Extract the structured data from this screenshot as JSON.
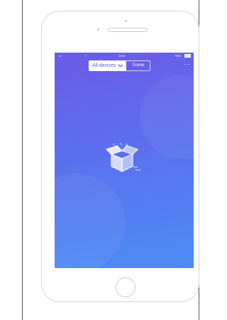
{
  "status_bar": {
    "signal": "•ıl",
    "wifi": "⌔",
    "time": "15:57",
    "battery_text": "99%"
  },
  "tabs": [
    {
      "label": "All devices",
      "active": true
    },
    {
      "label": "Scene",
      "active": false
    }
  ],
  "more_label": "···",
  "icons": {
    "dropdown": "chevron-down-icon",
    "empty": "empty-box-icon",
    "devices": "devices-grid-icon",
    "add": "add-icon",
    "profile": "profile-icon"
  },
  "colors": {
    "gradient_top": "#6a5be6",
    "gradient_bottom": "#4c8cf5",
    "accent_yellow": "#f5c400",
    "tab_text": "#4f64e6"
  }
}
